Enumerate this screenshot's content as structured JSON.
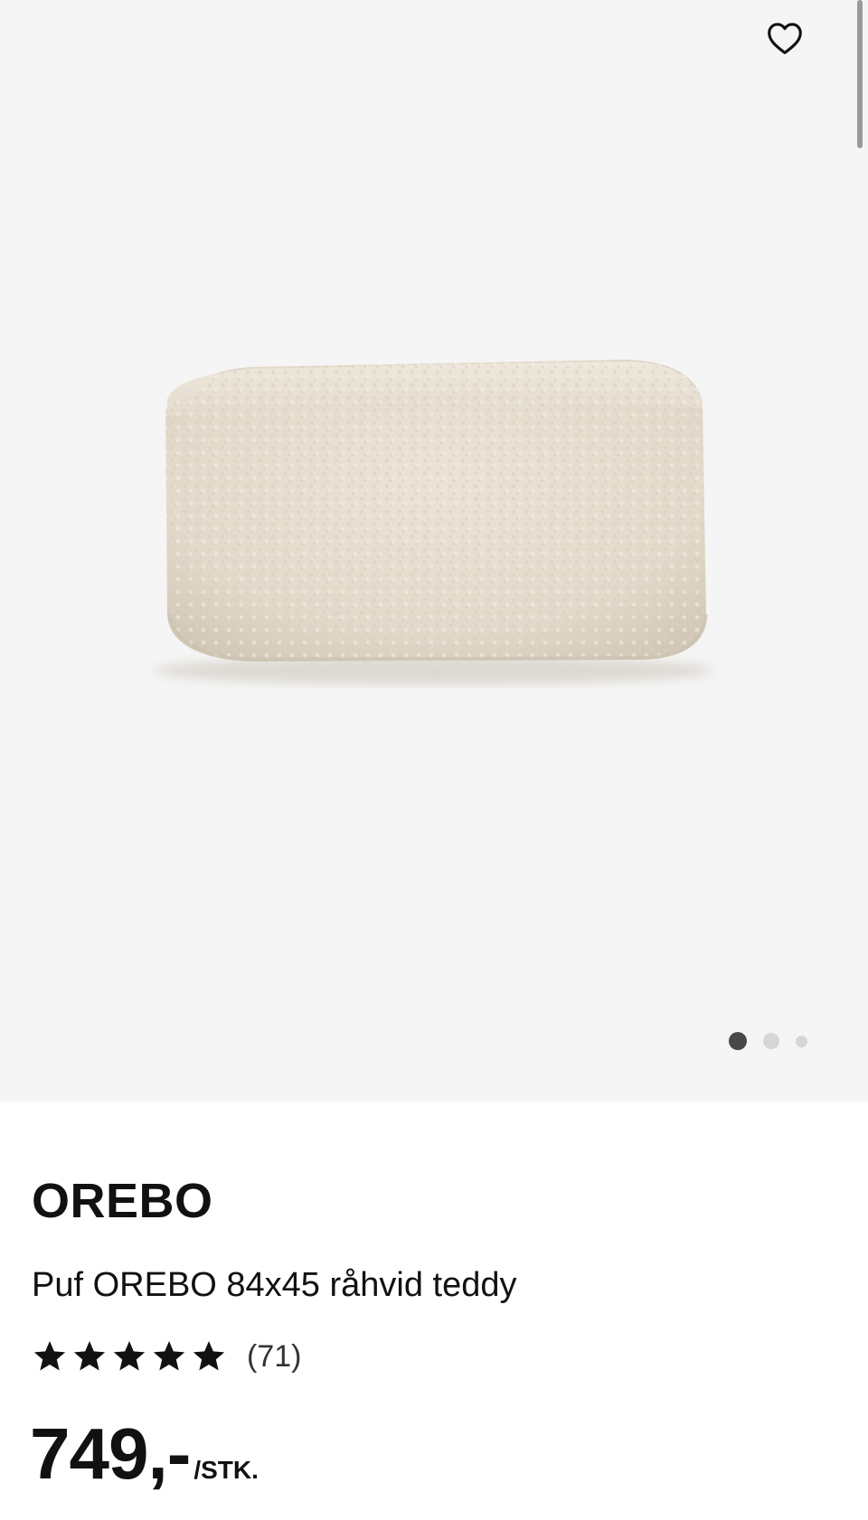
{
  "product": {
    "brand": "OREBO",
    "description": "Puf OREBO 84x45 råhvid teddy",
    "rating": {
      "stars": 5,
      "max": 5,
      "reviews_label": "(71)"
    },
    "price": {
      "value": "749,-",
      "unit": "/STK."
    }
  },
  "gallery": {
    "image_count": 3,
    "active_index": 0,
    "colors": {
      "background": "#f5f5f5",
      "pouf": "#e6ddcf",
      "pouf_shadow": "#cfc5b6"
    }
  },
  "icons": {
    "favorite": "heart-outline-icon",
    "rating_star": "star-icon"
  }
}
